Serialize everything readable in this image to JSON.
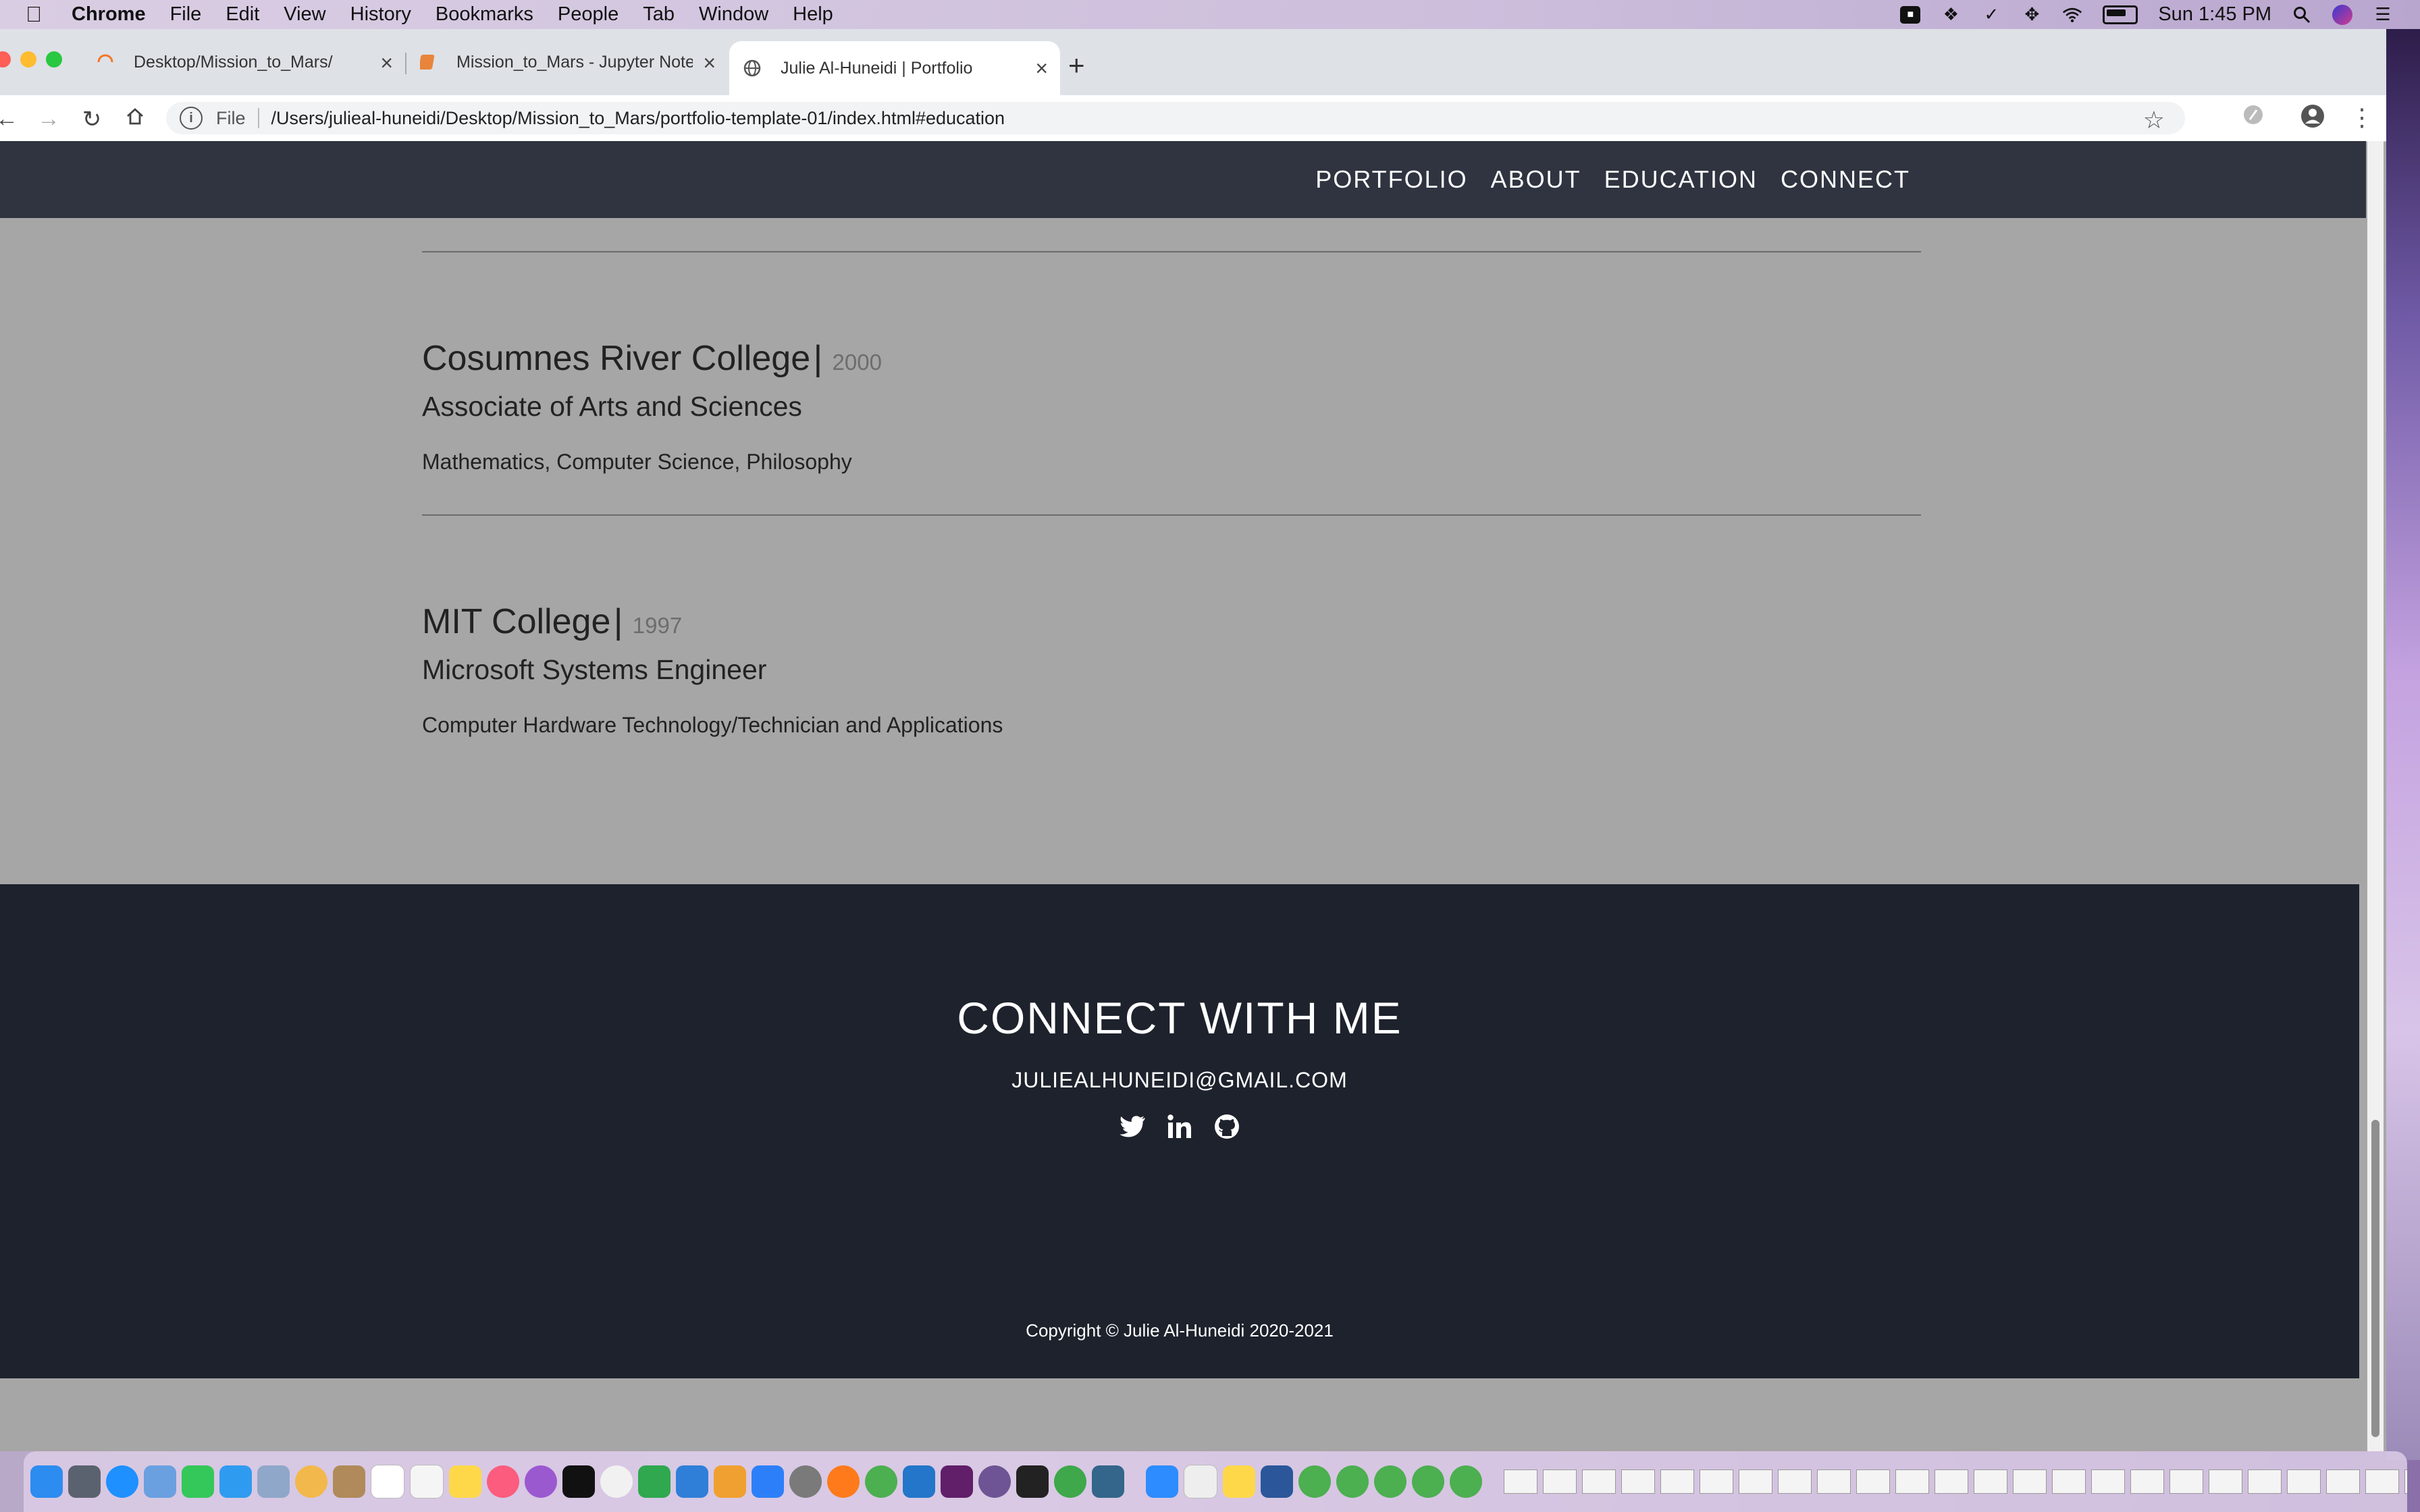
{
  "menubar": {
    "app_name": "Chrome",
    "menus": [
      "File",
      "Edit",
      "View",
      "History",
      "Bookmarks",
      "People",
      "Tab",
      "Window",
      "Help"
    ],
    "clock": "Sun 1:45 PM"
  },
  "tabs": [
    {
      "title": "Desktop/Mission_to_Mars/"
    },
    {
      "title": "Mission_to_Mars - Jupyter Noteb"
    },
    {
      "title": "Julie Al-Huneidi | Portfolio"
    }
  ],
  "toolbar": {
    "file_label": "File",
    "url": "/Users/julieal-huneidi/Desktop/Mission_to_Mars/portfolio-template-01/index.html#education"
  },
  "site_nav": {
    "links": [
      "PORTFOLIO",
      "ABOUT",
      "EDUCATION",
      "CONNECT"
    ]
  },
  "education": [
    {
      "school": "Cosumnes River College",
      "year": "2000",
      "degree": "Associate of Arts and Sciences",
      "subjects": "Mathematics, Computer Science, Philosophy"
    },
    {
      "school": "MIT College",
      "year": "1997",
      "degree": "Microsoft Systems Engineer",
      "subjects": "Computer Hardware Technology/Technician and Applications"
    }
  ],
  "footer": {
    "title": "CONNECT WITH ME",
    "email": "JULIEALHUNEIDI@GMAIL.COM",
    "socials": [
      "twitter-icon",
      "linkedin-icon",
      "github-icon"
    ],
    "copyright": "Copyright © Julie Al-Huneidi 2020-2021"
  },
  "colors": {
    "nav_bg": "#2f3440",
    "footer_bg": "#1d222c",
    "page_bg": "#a6a6a6"
  }
}
